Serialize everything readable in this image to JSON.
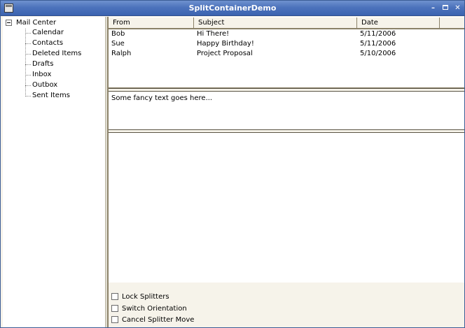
{
  "window": {
    "title": "SplitContainerDemo",
    "controls": {
      "minimize": "–",
      "close": "✕"
    }
  },
  "tree": {
    "root": "Mail Center",
    "children": [
      "Calendar",
      "Contacts",
      "Deleted Items",
      "Drafts",
      "Inbox",
      "Outbox",
      "Sent Items"
    ]
  },
  "list": {
    "columns": [
      "From",
      "Subject",
      "Date"
    ],
    "rows": [
      {
        "from": "Bob",
        "subject": "Hi There!",
        "date": "5/11/2006"
      },
      {
        "from": "Sue",
        "subject": "Happy Birthday!",
        "date": "5/11/2006"
      },
      {
        "from": "Ralph",
        "subject": "Project Proposal",
        "date": "5/10/2006"
      }
    ]
  },
  "text_panel": {
    "content": "Some fancy text goes here..."
  },
  "options": {
    "lock_splitters": "Lock Splitters",
    "switch_orientation": "Switch Orientation",
    "cancel_splitter_move": "Cancel Splitter Move"
  },
  "colors": {
    "titlebar": "#4d73bc",
    "panel": "#f6f3ea",
    "border": "#8a8168"
  }
}
